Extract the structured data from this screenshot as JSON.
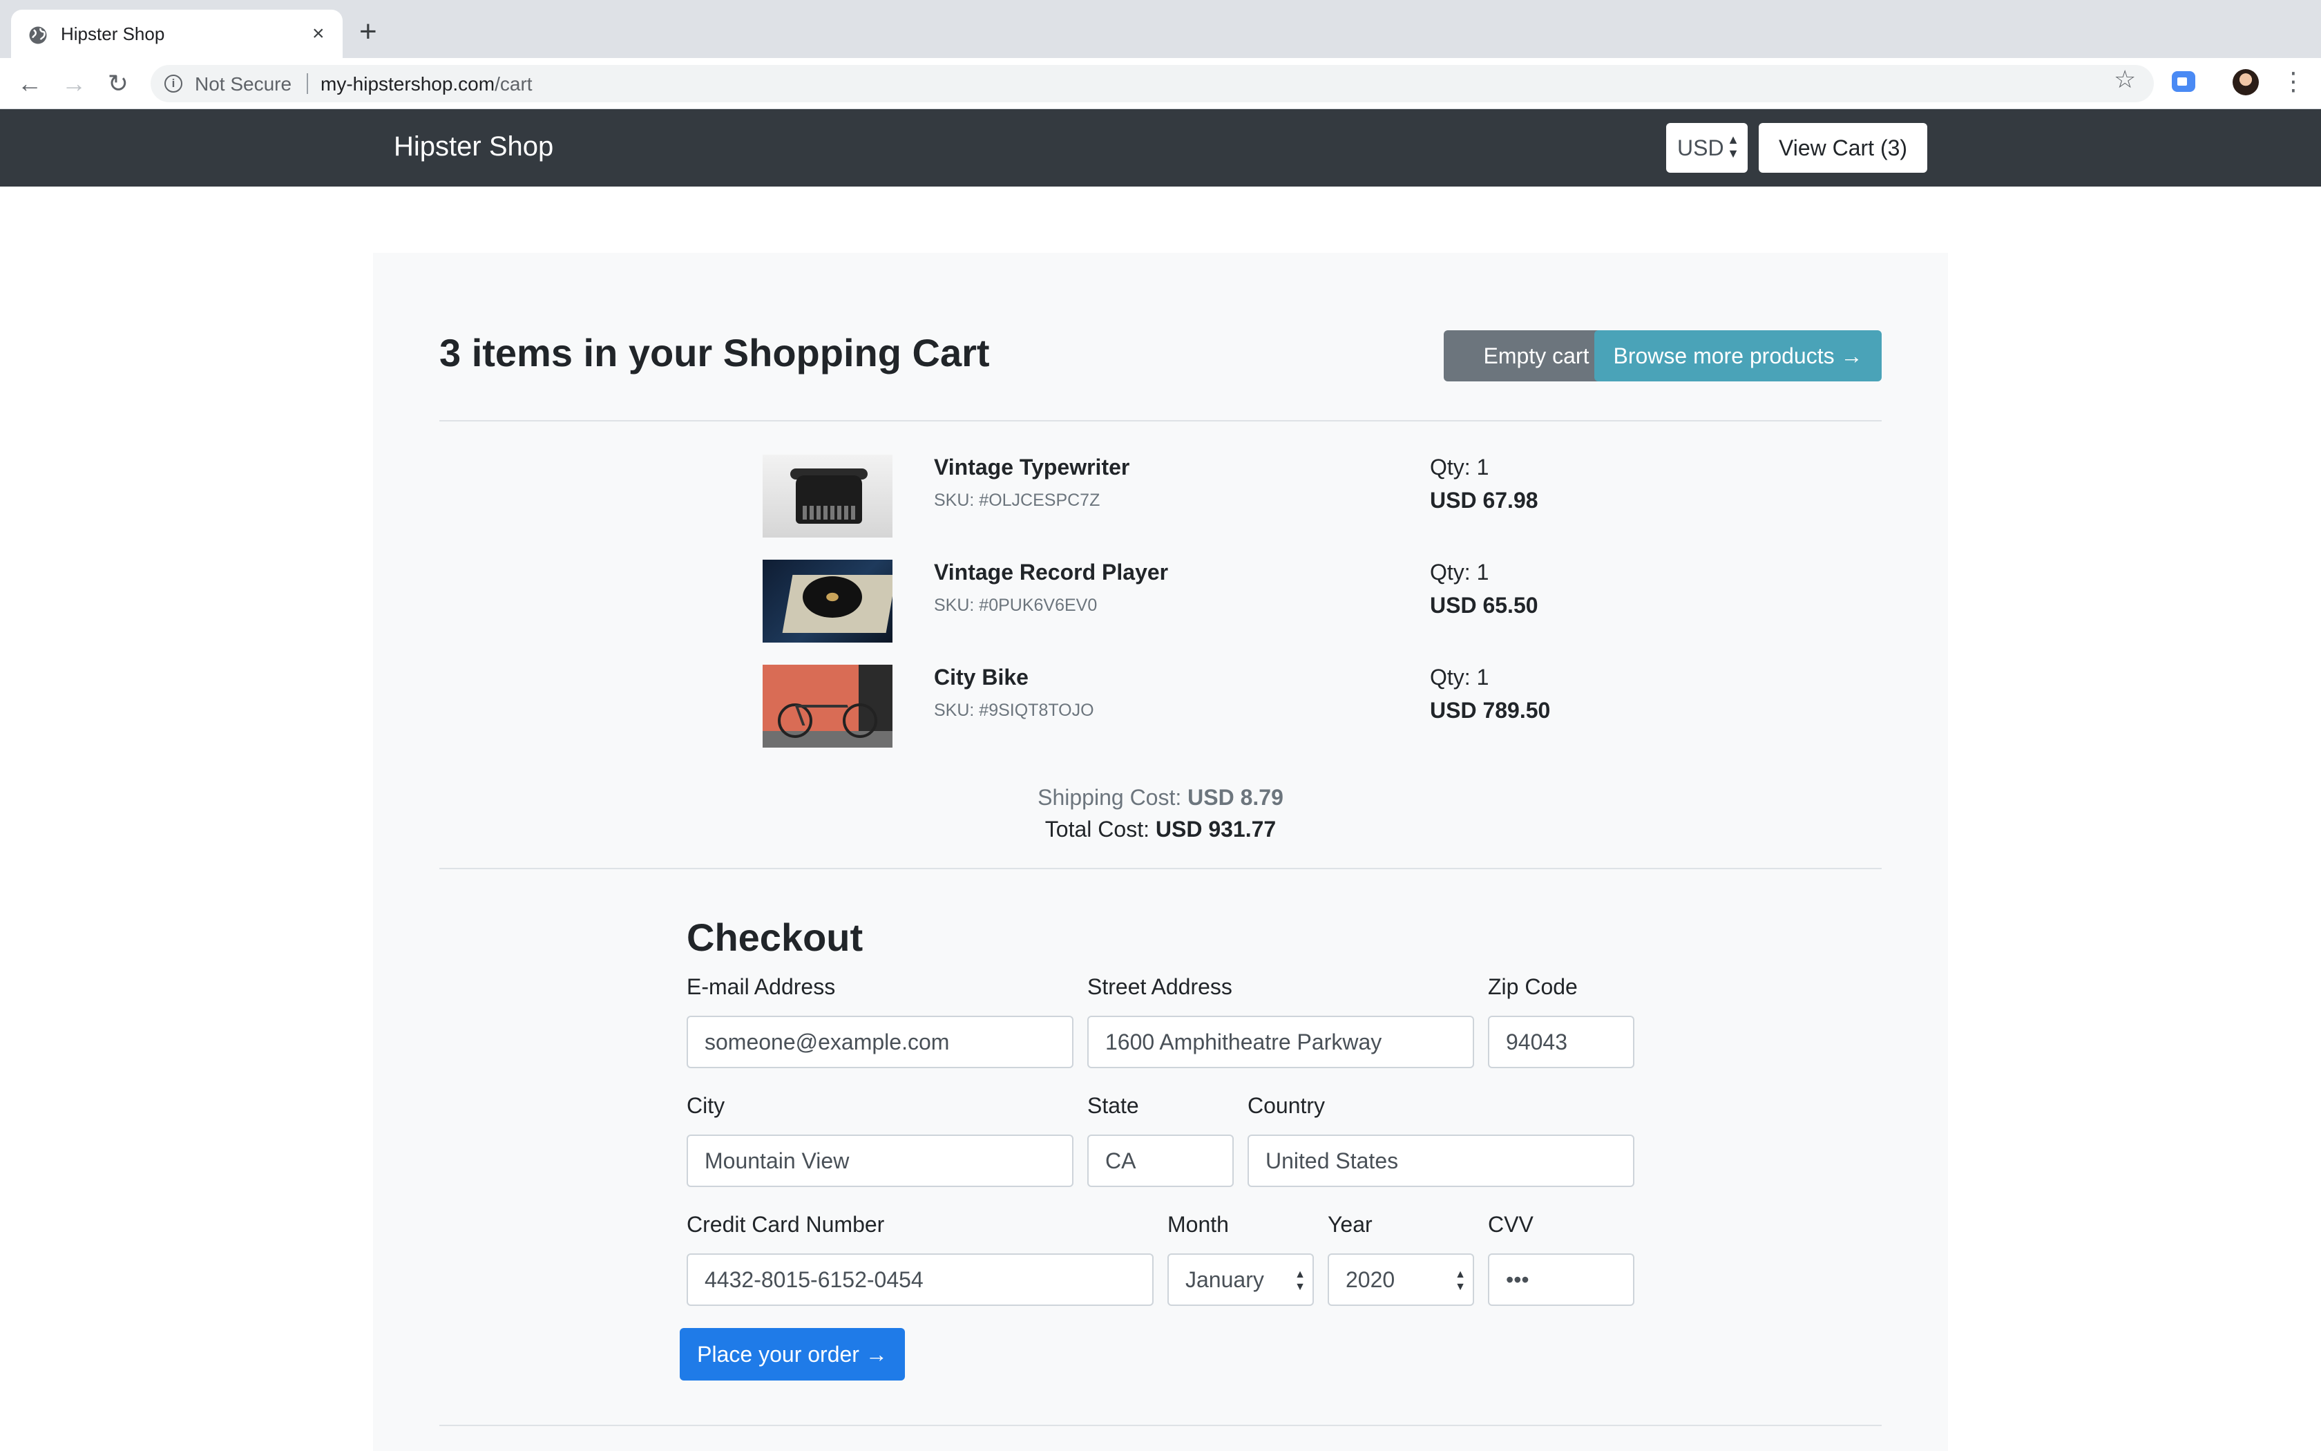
{
  "browser": {
    "tab_title": "Hipster Shop",
    "tab_close": "×",
    "new_tab": "+",
    "security_label": "Not Secure",
    "url_host": "my-hipstershop.com",
    "url_path": "/cart"
  },
  "header": {
    "brand": "Hipster Shop",
    "currency": "USD",
    "view_cart": "View Cart (3)"
  },
  "cart": {
    "title": "3 items in your Shopping Cart",
    "empty_label": "Empty cart",
    "browse_label": "Browse more products →",
    "items": [
      {
        "name": "Vintage Typewriter",
        "sku": "SKU: #OLJCESPC7Z",
        "qty": "Qty: 1",
        "price": "USD 67.98"
      },
      {
        "name": "Vintage Record Player",
        "sku": "SKU: #0PUK6V6EV0",
        "qty": "Qty: 1",
        "price": "USD 65.50"
      },
      {
        "name": "City Bike",
        "sku": "SKU: #9SIQT8TOJO",
        "qty": "Qty: 1",
        "price": "USD 789.50"
      }
    ],
    "shipping_label": "Shipping Cost:",
    "shipping_value": "USD 8.79",
    "total_label": "Total Cost:",
    "total_value": "USD 931.77"
  },
  "checkout": {
    "title": "Checkout",
    "email_label": "E-mail Address",
    "email_value": "someone@example.com",
    "street_label": "Street Address",
    "street_value": "1600 Amphitheatre Parkway",
    "zip_label": "Zip Code",
    "zip_value": "94043",
    "city_label": "City",
    "city_value": "Mountain View",
    "state_label": "State",
    "state_value": "CA",
    "country_label": "Country",
    "country_value": "United States",
    "cc_label": "Credit Card Number",
    "cc_value": "4432-8015-6152-0454",
    "month_label": "Month",
    "month_value": "January",
    "year_label": "Year",
    "year_value": "2020",
    "cvv_label": "CVV",
    "cvv_value": "•••",
    "place_order": "Place your order →"
  },
  "icons": {
    "back": "back-arrow-icon",
    "forward": "forward-arrow-icon",
    "reload": "reload-icon",
    "info": "info-icon",
    "star": "star-icon",
    "extension": "extension-icon",
    "menu": "kebab-menu-icon"
  },
  "colors": {
    "header_bg": "#343a40",
    "empty_btn": "#6c757d",
    "browse_btn": "#4aa3b8",
    "order_btn": "#1f7be8"
  }
}
